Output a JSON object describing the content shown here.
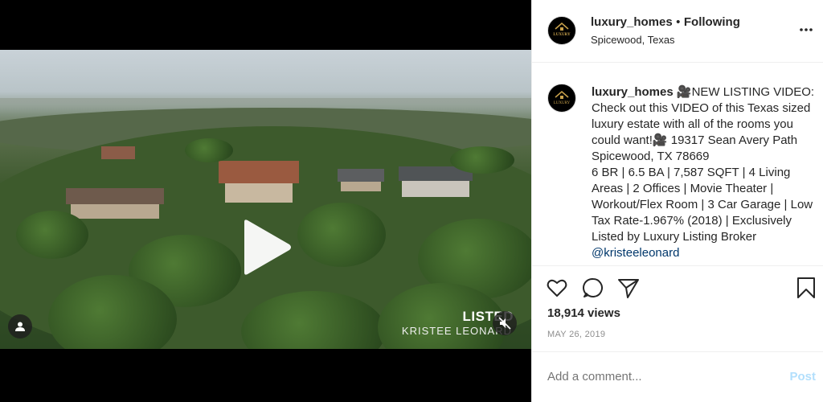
{
  "video": {
    "overlay_title": "LISTED",
    "overlay_subtitle": "KRISTEE LEONARD"
  },
  "header": {
    "username": "luxury_homes",
    "separator": "•",
    "follow_label": "Following",
    "location": "Spicewood, Texas",
    "avatar_text": "LUXURY HOMES"
  },
  "caption": {
    "username": "luxury_homes",
    "text": " 🎥NEW LISTING VIDEO: Check out this VIDEO of this Texas sized luxury estate with all of the rooms you could want!🎥 19317 Sean Avery Path Spicewood, TX 78669\n6 BR | 6.5 BA | 7,587 SQFT | 4 Living Areas | 2 Offices | Movie Theater | Workout/Flex Room | 3 Car Garage | Low Tax Rate-1.967% (2018) | Exclusively Listed by Luxury Listing Broker ",
    "mention": "@kristeeleonard"
  },
  "stats": {
    "views": "18,914 views",
    "date": "MAY 26, 2019"
  },
  "comment": {
    "placeholder": "Add a comment...",
    "post_label": "Post"
  },
  "icons": [
    "heart-icon",
    "comment-icon",
    "share-icon",
    "bookmark-icon",
    "more-icon",
    "play-icon",
    "mute-icon",
    "user-icon"
  ]
}
